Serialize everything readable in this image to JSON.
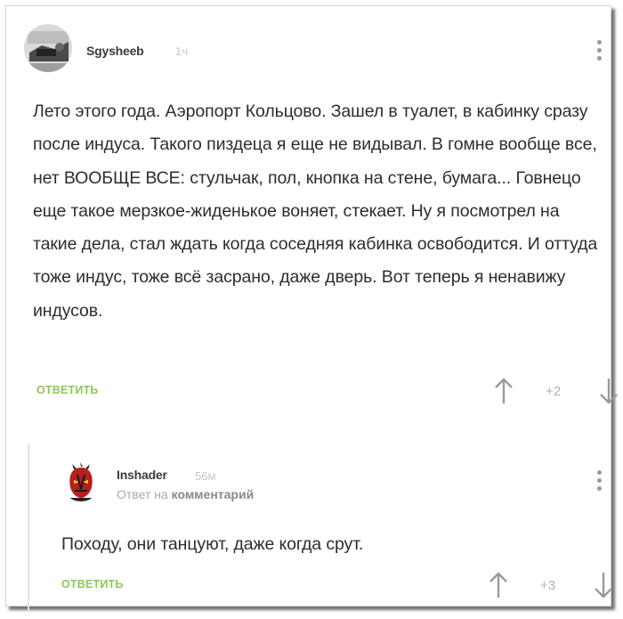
{
  "comments": [
    {
      "author": "Sgysheeb",
      "time": "1ч",
      "text": "Лето этого года. Аэропорт Кольцово. Зашел в туалет, в кабинку сразу после индуса. Такого пиздеца я еще не видывал. В гомне вообще все, нет ВООБЩЕ ВСЕ: стульчак, пол, кнопка на стене, бумага... Говнецо еще такое мерзкое-жиденькое воняет, стекает. Ну я посмотрел на такие дела, стал ждать когда соседняя кабинка освободится. И оттуда тоже индус, тоже всё засрано, даже дверь. Вот теперь я ненавижу индусов.",
      "reply_label": "ОТВЕТИТЬ",
      "score": "+2"
    },
    {
      "author": "Inshader",
      "time": "56м",
      "reply_prefix": "Ответ на",
      "reply_target": "комментарий",
      "text": "Походу, они танцуют, даже когда срут.",
      "reply_label": "ОТВЕТИТЬ",
      "score": "+3"
    }
  ],
  "colors": {
    "reply_green": "#8ac858",
    "meta_gray": "#b0b0b0",
    "text": "#2d2d2d"
  },
  "icons": [
    "avatar-sgysheeb",
    "avatar-inshader",
    "more-icon",
    "arrow-up-icon",
    "arrow-down-icon"
  ]
}
